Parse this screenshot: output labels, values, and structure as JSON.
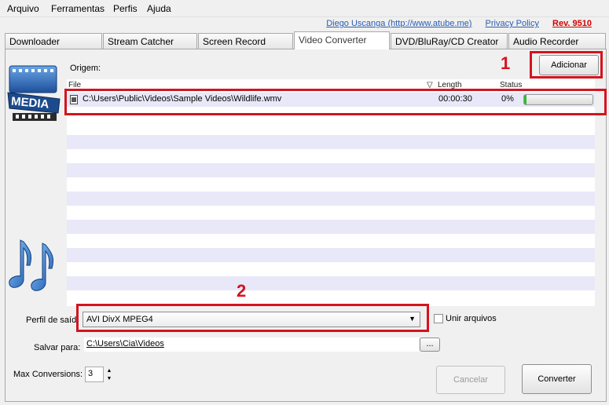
{
  "menu": [
    "Arquivo",
    "Ferramentas",
    "Perfis",
    "Ajuda"
  ],
  "top_links": {
    "author": "Diego Uscanga (http://www.atube.me)",
    "privacy": "Privacy Policy",
    "revision": "Rev. 9510"
  },
  "tabs": [
    "Downloader",
    "Stream Catcher",
    "Screen Record",
    "Video Converter",
    "DVD/BluRay/CD Creator",
    "Audio Recorder"
  ],
  "active_tab": "Video Converter",
  "origem_label": "Origem:",
  "add_button": "Adicionar",
  "file_list": {
    "columns": {
      "file": "File",
      "length": "Length",
      "status": "Status"
    },
    "rows": [
      {
        "path": "C:\\Users\\Public\\Videos\\Sample Videos\\Wildlife.wmv",
        "length": "00:00:30",
        "status": "0%",
        "progress": 0.03
      }
    ]
  },
  "media_icon_text": "MEDIA",
  "annotations": {
    "one": "1",
    "two": "2"
  },
  "profile": {
    "label": "Perfil de saíd",
    "selected": "AVI DivX MPEG4"
  },
  "merge_label": "Unir arquivos",
  "save": {
    "label": "Salvar para:",
    "path": "C:\\Users\\Cia\\Videos",
    "browse": "..."
  },
  "max_conversions": {
    "label": "Max Conversions:",
    "value": "3"
  },
  "cancel_button": "Cancelar",
  "convert_button": "Converter",
  "colors": {
    "highlight": "#d4141e",
    "progress": "#36b836",
    "link": "#2a5db0",
    "stripe": "#e8e8f8"
  }
}
